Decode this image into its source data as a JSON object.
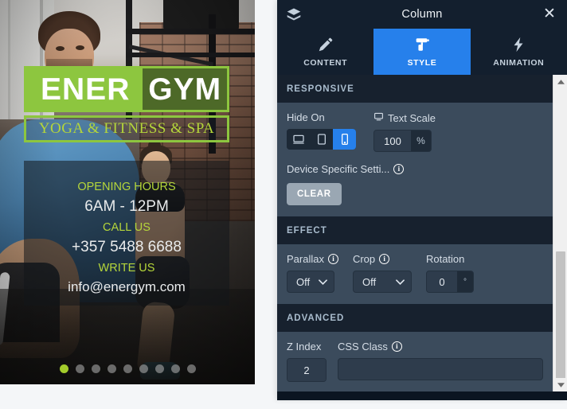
{
  "preview": {
    "logo": {
      "word_1": "ENER",
      "word_2": "GYM",
      "tagline": "YOGA & FITNESS & SPA",
      "green": "#8dc63f"
    },
    "info": {
      "hours_label": "OPENING HOURS",
      "hours_value": "6AM - 12PM",
      "call_label": "CALL US",
      "phone": "+357 5488 6688",
      "write_label": "WRITE US",
      "email": "info@energym.com",
      "label_color": "#b5d63a"
    },
    "slider": {
      "total_dots": 9,
      "active_index": 0,
      "active_color": "#a3cc2b"
    }
  },
  "panel": {
    "header": {
      "title": "Column",
      "layers_icon": "layers-icon",
      "close_icon": "close-icon"
    },
    "tabs": [
      {
        "label": "CONTENT",
        "icon": "pencil-icon",
        "active": false
      },
      {
        "label": "STYLE",
        "icon": "paint-roller-icon",
        "active": true
      },
      {
        "label": "ANIMATION",
        "icon": "lightning-bolt-icon",
        "active": false
      }
    ],
    "accent": "#2680eb",
    "sections": {
      "responsive": {
        "title": "RESPONSIVE",
        "hide_on_label": "Hide On",
        "devices": [
          {
            "name": "desktop",
            "active": false
          },
          {
            "name": "tablet",
            "active": false
          },
          {
            "name": "mobile",
            "active": true
          }
        ],
        "text_scale_label": "Text Scale",
        "text_scale_icon": "monitor-icon",
        "text_scale_value": "100",
        "text_scale_unit": "%",
        "device_specific_label": "Device Specific Setti...",
        "clear_label": "CLEAR"
      },
      "effect": {
        "title": "EFFECT",
        "parallax_label": "Parallax",
        "parallax_value": "Off",
        "crop_label": "Crop",
        "crop_value": "Off",
        "rotation_label": "Rotation",
        "rotation_value": "0",
        "rotation_unit": "°"
      },
      "advanced": {
        "title": "ADVANCED",
        "z_index_label": "Z Index",
        "z_index_value": "2",
        "css_class_label": "CSS Class",
        "css_class_value": "",
        "css_class_placeholder": ""
      }
    },
    "scrollbar": {
      "up_icon": "caret-up-icon",
      "down_icon": "caret-down-icon"
    }
  }
}
